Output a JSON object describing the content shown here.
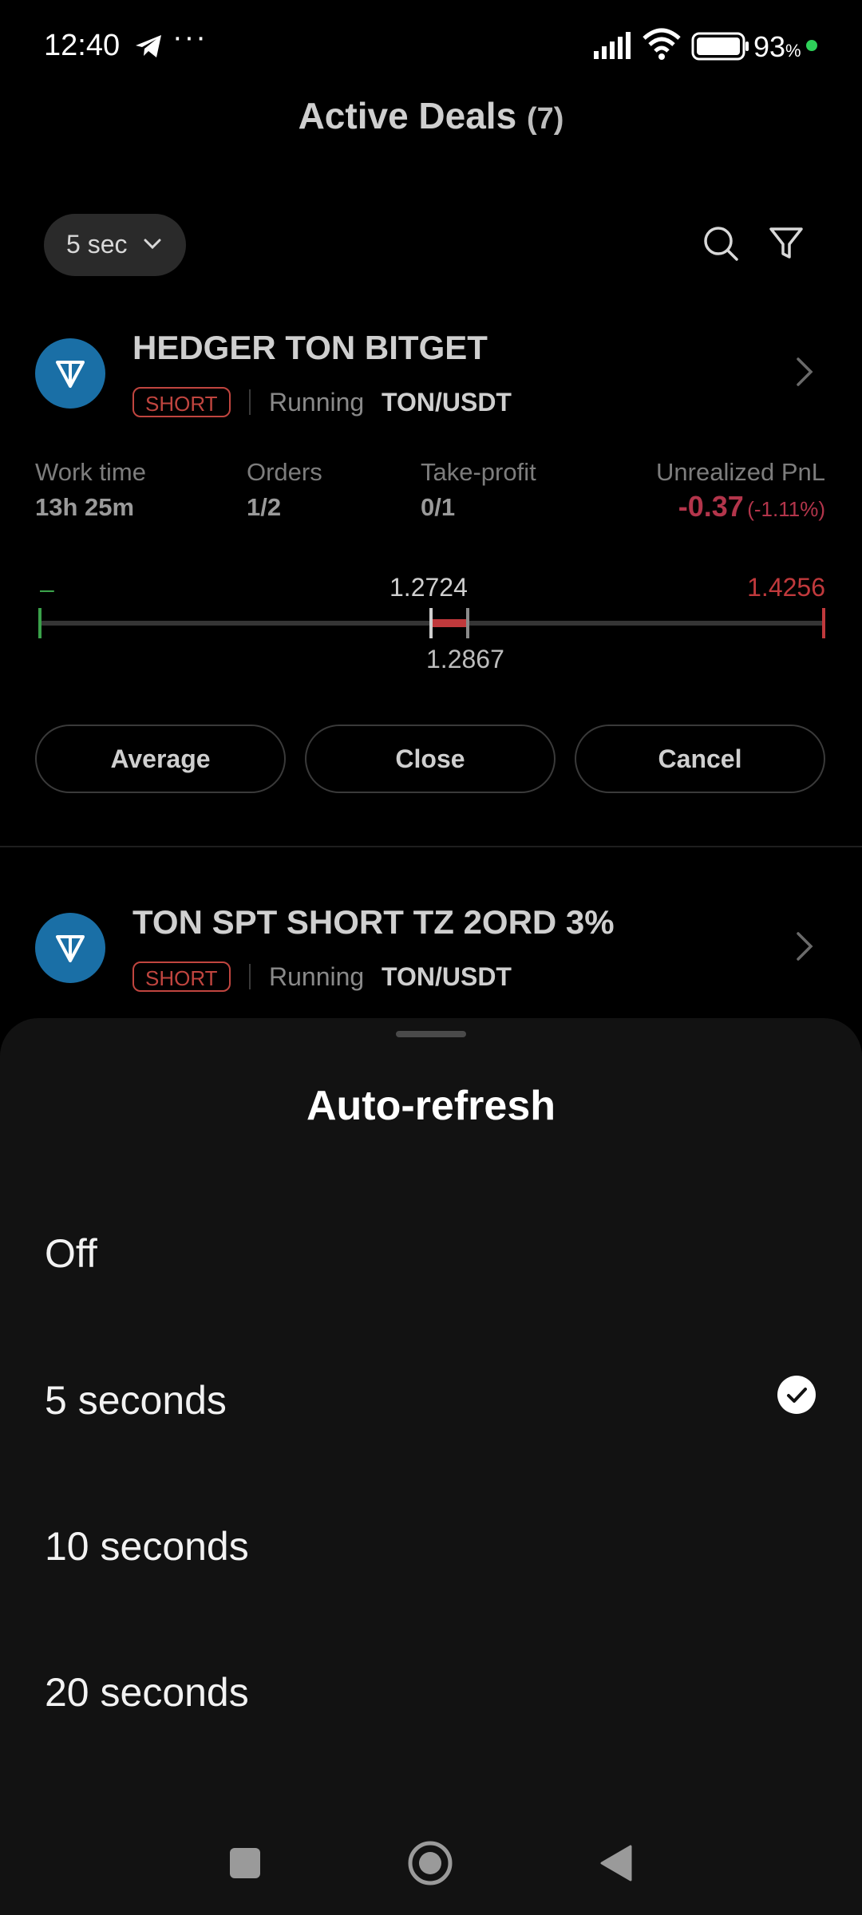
{
  "status_bar": {
    "time": "12:40",
    "dots": "···",
    "battery_percent": "93",
    "battery_unit": "%",
    "icons": [
      "telegram-icon",
      "signal-icon",
      "wifi-icon",
      "battery-icon"
    ]
  },
  "header": {
    "title": "Active Deals",
    "count": "(7)",
    "interval": "5 sec"
  },
  "deals": [
    {
      "name": "HEDGER TON BITGET",
      "side": "SHORT",
      "status": "Running",
      "pair": "TON/USDT",
      "stats": {
        "work_time_label": "Work time",
        "work_time": "13h 25m",
        "orders_label": "Orders",
        "orders": "1/2",
        "take_profit_label": "Take-profit",
        "take_profit": "0/1",
        "pnl_label": "Unrealized PnL",
        "pnl": "-0.37",
        "pnl_pct": "(-1.11%)"
      },
      "range": {
        "left": "–",
        "mid_top": "1.2724",
        "mid_bottom": "1.2867",
        "right": "1.4256"
      },
      "buttons": [
        "Average",
        "Close",
        "Cancel"
      ]
    },
    {
      "name": "TON SPT SHORT TZ 2ORD 3%",
      "side": "SHORT",
      "status": "Running",
      "pair": "TON/USDT"
    }
  ],
  "sheet": {
    "title": "Auto-refresh",
    "options": [
      "Off",
      "5 seconds",
      "10 seconds",
      "20 seconds"
    ],
    "selected": "5 seconds"
  },
  "colors": {
    "accent_red": "#c0453f",
    "pnl_red": "#b3354b",
    "coin_blue": "#1a6fa6",
    "tick_green": "#3aa14a"
  }
}
